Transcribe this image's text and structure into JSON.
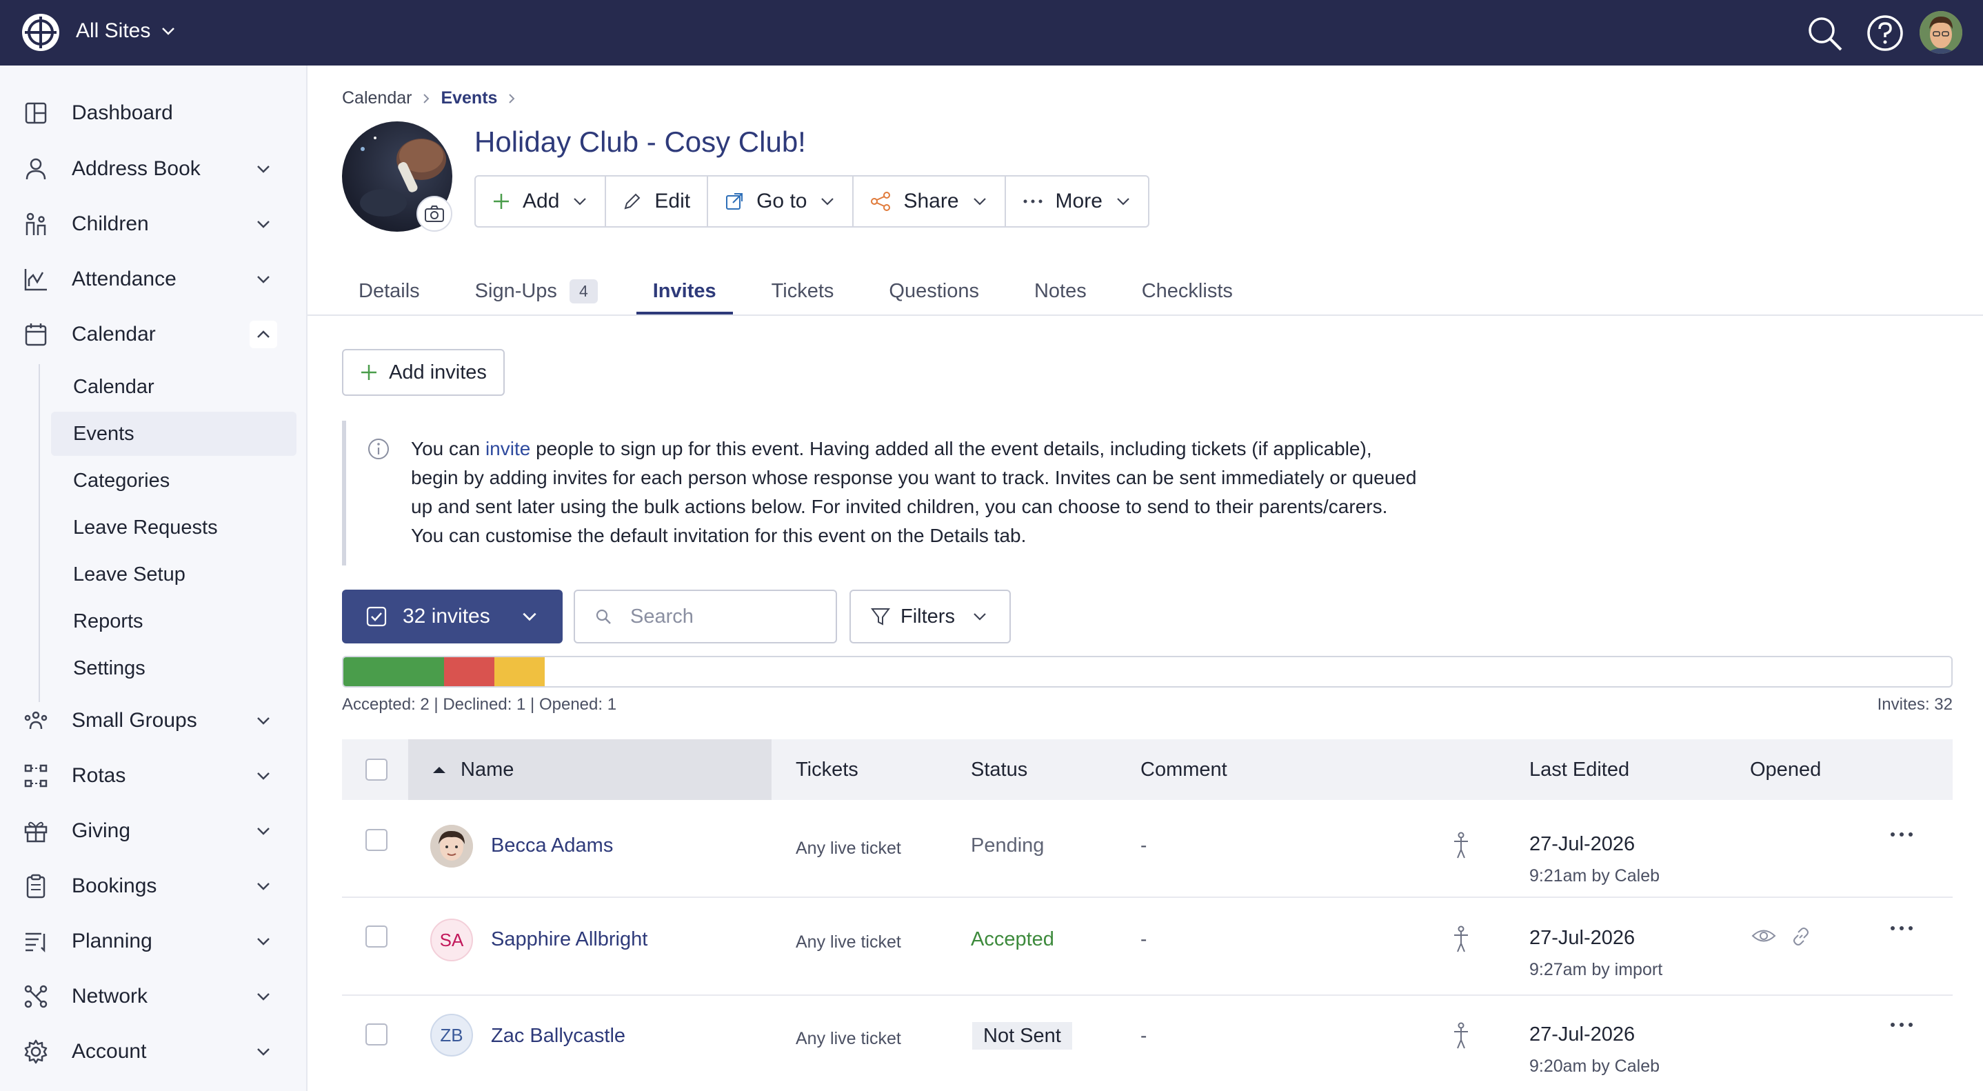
{
  "topbar": {
    "site_selector": "All Sites"
  },
  "sidebar": {
    "items": [
      {
        "label": "Dashboard",
        "icon": "dashboard-icon"
      },
      {
        "label": "Address Book",
        "icon": "person-icon"
      },
      {
        "label": "Children",
        "icon": "children-icon"
      },
      {
        "label": "Attendance",
        "icon": "attendance-chart-icon"
      },
      {
        "label": "Calendar",
        "icon": "calendar-icon"
      },
      {
        "label": "Small Groups",
        "icon": "small-groups-icon"
      },
      {
        "label": "Rotas",
        "icon": "rotas-icon"
      },
      {
        "label": "Giving",
        "icon": "gift-icon"
      },
      {
        "label": "Bookings",
        "icon": "clipboard-icon"
      },
      {
        "label": "Planning",
        "icon": "planning-icon"
      },
      {
        "label": "Network",
        "icon": "network-icon"
      },
      {
        "label": "Account",
        "icon": "gear-icon"
      }
    ],
    "calendar_sub": [
      "Calendar",
      "Events",
      "Categories",
      "Leave Requests",
      "Leave Setup",
      "Reports",
      "Settings"
    ],
    "active_sub": "Events"
  },
  "breadcrumb": {
    "root": "Calendar",
    "current": "Events"
  },
  "event": {
    "title": "Holiday Club - Cosy Club!"
  },
  "actions": {
    "add": "Add",
    "edit": "Edit",
    "goto": "Go to",
    "share": "Share",
    "more": "More"
  },
  "tabs": [
    {
      "label": "Details"
    },
    {
      "label": "Sign-Ups",
      "badge": "4"
    },
    {
      "label": "Invites",
      "active": true
    },
    {
      "label": "Tickets"
    },
    {
      "label": "Questions"
    },
    {
      "label": "Notes"
    },
    {
      "label": "Checklists"
    }
  ],
  "add_invites_label": "Add invites",
  "info": {
    "prefix": "You can ",
    "link": "invite",
    "line1_rest": " people to sign up for this event. Having added all the event details, including tickets (if applicable),",
    "line2": "begin by adding invites for each person whose response you want to track. Invites can be sent immediately or queued",
    "line3": "up and sent later using the bulk actions below. For invited children, you can choose to send to their parents/carers.",
    "line4": "You can customise the default invitation for this event on the Details tab."
  },
  "toolbar": {
    "select_label": "32 invites",
    "search_placeholder": "Search",
    "filters_label": "Filters"
  },
  "progress": {
    "total": 32,
    "accepted": 2,
    "declined": 1,
    "opened": 1,
    "colors": {
      "accepted": "#4a9d4b",
      "declined": "#d9534f",
      "opened": "#f0c040"
    }
  },
  "stats": {
    "left": "Accepted: 2 | Declined: 1 | Opened: 1",
    "right": "Invites: 32"
  },
  "table": {
    "headers": {
      "name": "Name",
      "tickets": "Tickets",
      "status": "Status",
      "comment": "Comment",
      "last_edited": "Last Edited",
      "opened": "Opened"
    },
    "rows": [
      {
        "initials": "",
        "name": "Becca Adams",
        "ticket": "Any live ticket",
        "status": "Pending",
        "comment": "-",
        "date": "27-Jul-2026",
        "by": "9:21am by Caleb",
        "opened": false
      },
      {
        "initials": "SA",
        "name": "Sapphire Allbright",
        "ticket": "Any live ticket",
        "status": "Accepted",
        "comment": "-",
        "date": "27-Jul-2026",
        "by": "9:27am by import",
        "opened": true
      },
      {
        "initials": "ZB",
        "name": "Zac Ballycastle",
        "ticket": "Any live ticket",
        "status": "Not Sent",
        "comment": "-",
        "date": "27-Jul-2026",
        "by": "9:20am by Caleb",
        "opened": false
      }
    ]
  }
}
